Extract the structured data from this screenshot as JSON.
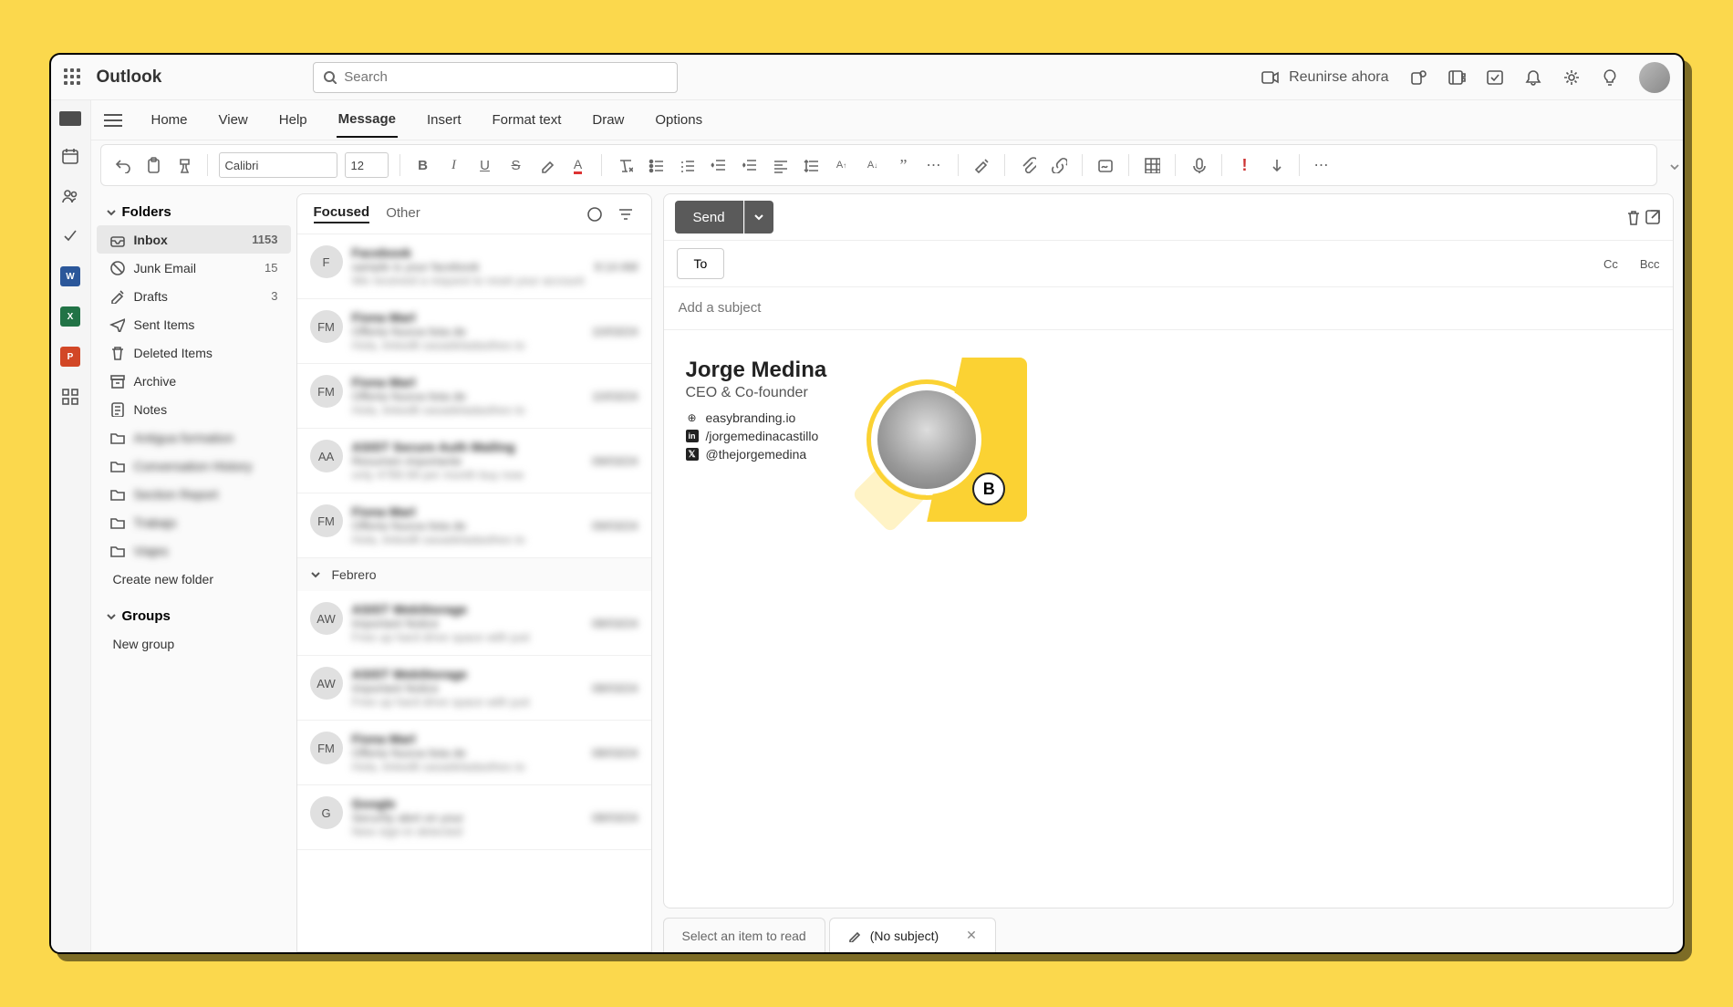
{
  "app": {
    "title": "Outlook"
  },
  "search": {
    "placeholder": "Search"
  },
  "meet": {
    "label": "Reunirse ahora"
  },
  "tabs": {
    "home": "Home",
    "view": "View",
    "help": "Help",
    "message": "Message",
    "insert": "Insert",
    "format_text": "Format text",
    "draw": "Draw",
    "options": "Options"
  },
  "ribbon": {
    "font": "Calibri",
    "size": "12"
  },
  "folders": {
    "header": "Folders",
    "items": [
      {
        "label": "Inbox",
        "count": "1153",
        "active": true
      },
      {
        "label": "Junk Email",
        "count": "15"
      },
      {
        "label": "Drafts",
        "count": "3"
      },
      {
        "label": "Sent Items"
      },
      {
        "label": "Deleted Items"
      },
      {
        "label": "Archive"
      },
      {
        "label": "Notes"
      },
      {
        "label": "Antigua formation",
        "blur": true
      },
      {
        "label": "Conversation History",
        "blur": true
      },
      {
        "label": "Section Report",
        "blur": true
      },
      {
        "label": "Trabajo",
        "blur": true
      },
      {
        "label": "Viajes",
        "blur": true
      }
    ],
    "create": "Create new folder",
    "groups_header": "Groups",
    "new_group": "New group"
  },
  "msglist": {
    "tabs": {
      "focused": "Focused",
      "other": "Other"
    },
    "group_sep": "Febrero",
    "items": [
      {
        "av": "F",
        "l1": "Facebook",
        "l2": "sample is your facebook",
        "date": "9:14 AM",
        "l3": "We received a request to reset your account"
      },
      {
        "av": "FM",
        "l1": "Fiona Marl",
        "l2": "Offerta Nuova lista de",
        "date": "10/03/24",
        "l3": "Hola, linkedlt sasadeladasthes to"
      },
      {
        "av": "FM",
        "l1": "Fiona Marl",
        "l2": "Offerta Nuova lista de",
        "date": "10/03/24",
        "l3": "Hola, linkedlt sasadeladasthes to"
      },
      {
        "av": "AA",
        "l1": "ASIST Secure Auth Mailing",
        "l2": "Resumen importante",
        "date": "09/03/24",
        "l3": "only 4789.99 per month buy now"
      },
      {
        "av": "FM",
        "l1": "Fiona Marl",
        "l2": "Offerta Nuova lista de",
        "date": "09/03/24",
        "l3": "Hola, linkedlt sasadeladasthes to"
      },
      {
        "av": "AW",
        "l1": "ASIST WebStorage",
        "l2": "Important Notice",
        "date": "08/03/24",
        "l3": "Free up hard drive space with just"
      },
      {
        "av": "AW",
        "l1": "ASIST WebStorage",
        "l2": "Important Notice",
        "date": "08/03/24",
        "l3": "Free up hard drive space with just"
      },
      {
        "av": "FM",
        "l1": "Fiona Marl",
        "l2": "Offerta Nuova lista de",
        "date": "08/03/24",
        "l3": "Hola, linkedlt sasadeladasthes to"
      },
      {
        "av": "G",
        "l1": "Google",
        "l2": "Security alert on your",
        "date": "08/03/24",
        "l3": "New sign-in detected"
      }
    ]
  },
  "compose": {
    "send": "Send",
    "to": "To",
    "cc": "Cc",
    "bcc": "Bcc",
    "subject_placeholder": "Add a subject"
  },
  "signature": {
    "name": "Jorge Medina",
    "role": "CEO & Co-founder",
    "website": "easybranding.io",
    "linkedin": "/jorgemedinacastillo",
    "twitter": "@thejorgemedina",
    "badge": "B"
  },
  "bottom_tabs": {
    "reading": "Select an item to read",
    "nosubject": "(No subject)"
  }
}
